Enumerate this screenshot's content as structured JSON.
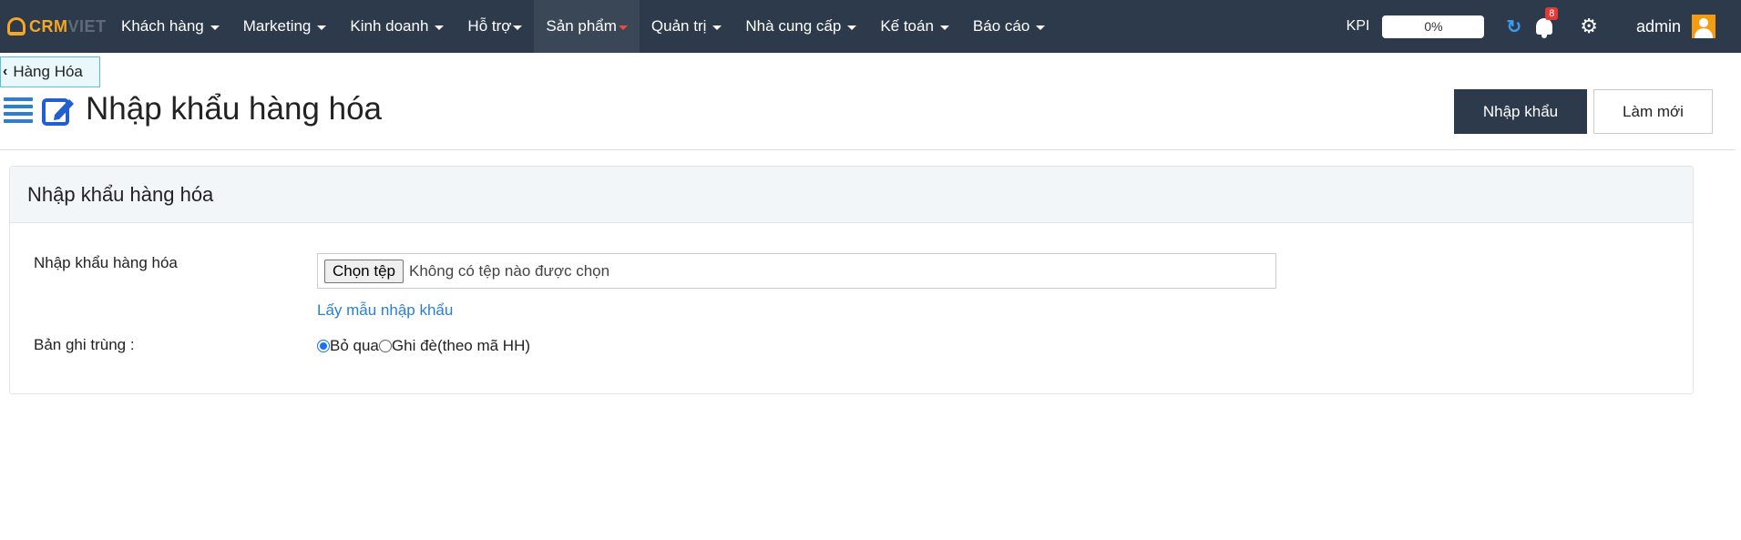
{
  "logo": {
    "part1": "CRM",
    "part2": "VIET"
  },
  "nav": {
    "items": [
      {
        "label": "Khách hàng"
      },
      {
        "label": "Marketing"
      },
      {
        "label": "Kinh doanh"
      },
      {
        "label": "Hỗ trợ"
      },
      {
        "label": "Sản phẩm"
      },
      {
        "label": "Quản trị"
      },
      {
        "label": "Nhà cung cấp"
      },
      {
        "label": "Kế toán"
      },
      {
        "label": "Báo cáo"
      }
    ],
    "active_item": "Sản phẩm",
    "kpi_label": "KPI",
    "kpi_value": "0%",
    "notification_count": "8",
    "user_name": "admin",
    "icons": [
      "refresh-icon",
      "bell-icon",
      "gear-icon",
      "user-avatar-icon"
    ]
  },
  "back_link": {
    "label": "Hàng Hóa"
  },
  "header": {
    "title": "Nhập khẩu hàng hóa",
    "import_button": "Nhập khẩu",
    "reset_button": "Làm mới"
  },
  "panel": {
    "heading": "Nhập khẩu hàng hóa",
    "file_label": "Nhập khẩu hàng hóa",
    "file_button": "Chọn tệp",
    "file_status": "Không có tệp nào được chọn",
    "sample_link": "Lấy mẫu nhập khẩu",
    "duplicate_label": "Bản ghi trùng :",
    "options": [
      {
        "label": "Bỏ qua",
        "checked": true
      },
      {
        "label": "Ghi đè(theo mã HH)",
        "checked": false
      }
    ]
  },
  "colors": {
    "nav_bg": "#2c3a4b",
    "brand_orange": "#f5a623",
    "accent_blue": "#2a7fd4",
    "badge_red": "#e53935"
  }
}
